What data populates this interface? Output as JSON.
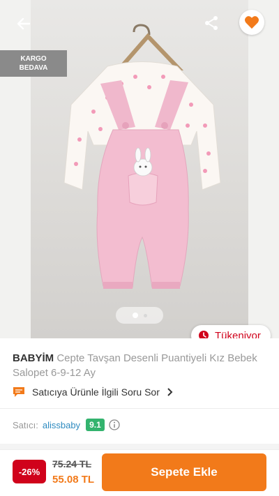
{
  "badges": {
    "cargo_line1": "KARGO",
    "cargo_line2": "BEDAVA",
    "stock": "Tükeniyor"
  },
  "carousel": {
    "current": 1,
    "total": 2
  },
  "product": {
    "brand": "BABYİM",
    "name": "Cepte Tavşan Desenli Puantiyeli Kız Bebek Salopet 6-9-12 Ay"
  },
  "question": {
    "label": "Satıcıya Ürünle İlgili Soru Sor"
  },
  "seller": {
    "label": "Satıcı:",
    "name": "alissbaby",
    "score": "9.1"
  },
  "price": {
    "discount": "-26%",
    "old": "75.24 TL",
    "new": "55.08 TL"
  },
  "cart": {
    "button_label": "Sepete Ekle"
  },
  "icons": [
    "back-arrow-icon",
    "share-icon",
    "heart-icon",
    "clock-icon",
    "chat-icon",
    "chevron-right-icon",
    "info-icon"
  ],
  "colors": {
    "accent": "#f27a1a",
    "danger": "#d0021b",
    "score": "#33b36e",
    "link": "#2e8bc0"
  }
}
